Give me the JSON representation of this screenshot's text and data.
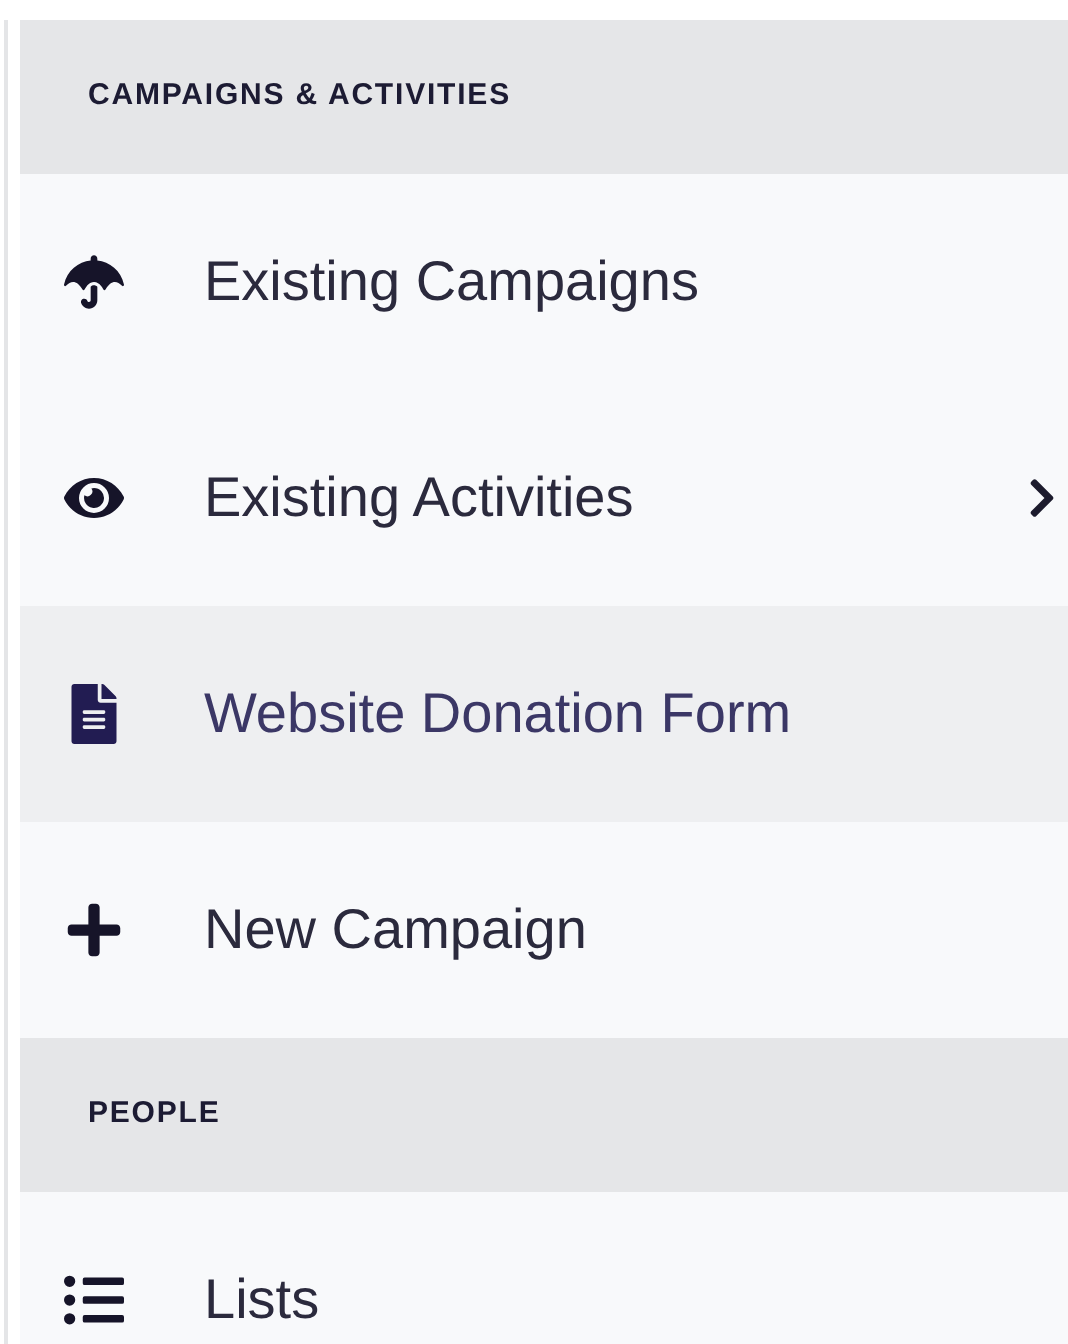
{
  "sections": [
    {
      "title": "CAMPAIGNS & ACTIVITIES",
      "items": [
        {
          "label": "Existing Campaigns",
          "selected": false,
          "submenu": false
        },
        {
          "label": "Existing Activities",
          "selected": false,
          "submenu": true
        },
        {
          "label": "Website Donation Form",
          "selected": true,
          "submenu": false
        },
        {
          "label": "New Campaign",
          "selected": false,
          "submenu": false
        }
      ]
    },
    {
      "title": "PEOPLE",
      "items": [
        {
          "label": "Lists",
          "selected": false,
          "submenu": false
        }
      ]
    }
  ]
}
